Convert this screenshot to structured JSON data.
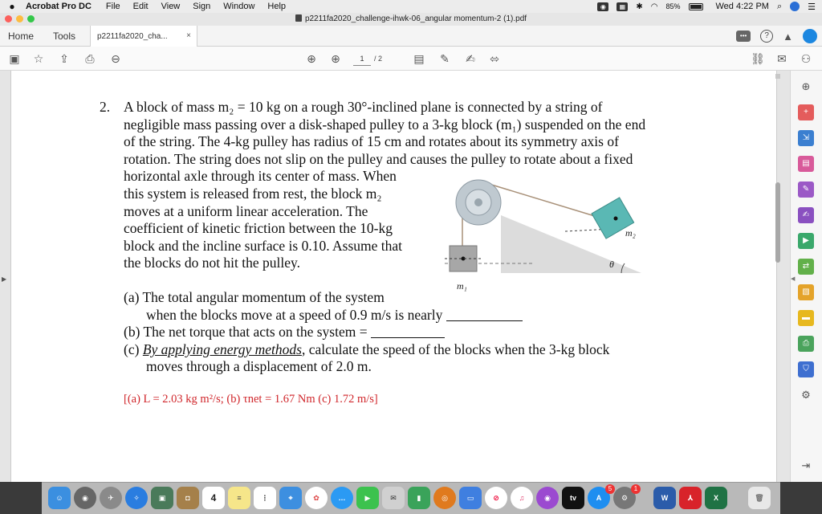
{
  "menubar": {
    "apple": "",
    "app_name": "Acrobat Pro DC",
    "items": [
      "File",
      "Edit",
      "View",
      "Sign",
      "Window",
      "Help"
    ],
    "status": {
      "battery": "85%",
      "clock": "Wed 4:22 PM",
      "battery_level": 0.85
    }
  },
  "window": {
    "title": "p2211fa2020_challenge-ihwk-06_angular momentum-2 (1).pdf"
  },
  "nav": {
    "home": "Home",
    "tools": "Tools",
    "doc_tab": "p2211fa2020_cha...",
    "close": "×"
  },
  "toolbar": {
    "page_current": "1",
    "page_total": "/ 2"
  },
  "problem": {
    "number": "2.",
    "lines": [
      "A block of mass m₂ = 10 kg on a rough 30°-inclined plane is connected by a string of",
      "negligible mass passing over a disk-shaped pulley to a 3-kg block (m₁) suspended on the end",
      "of the string. The 4-kg pulley has radius of 15 cm and rotates about its symmetry axis of",
      "rotation. The string does not slip on the pulley and causes the pulley to rotate about a fixed",
      "horizontal axle through its center of mass. When",
      "this system is released from rest, the block m₂",
      "moves at a uniform linear acceleration. The",
      "coefficient of kinetic friction between the 10-kg",
      "block and the incline surface is 0.10. Assume that",
      "the blocks do not hit the pulley."
    ],
    "a1": "(a) The total angular momentum of the system",
    "a2": "when the blocks move at a speed of 0.9 m/s is nearly",
    "b": "(b) The net torque that acts on the system =",
    "c1_pre": "(c) ",
    "c1_u": "By applying energy methods",
    "c1_post": ", calculate the speed of the blocks when the 3-kg block",
    "c2": "moves through a displacement of 2.0 m.",
    "answer": "[(a) L = 2.03 kg m²/s; (b) τnet = 1.67 Nm (c) 1.72 m/s]",
    "fig_m1": "m₁",
    "fig_m2": "m₂",
    "fig_theta": "θ"
  },
  "dock": {
    "calendar_day": "4",
    "appletv": "tv",
    "appstore_badge": "5",
    "sysprefs_badge": "1",
    "word": "W",
    "excel": "X"
  },
  "colors": {
    "accent": "#1c87e0",
    "answer_red": "#d0252a",
    "close_red": "#fc605c",
    "min_yellow": "#fdbc40",
    "max_green": "#34c749"
  }
}
